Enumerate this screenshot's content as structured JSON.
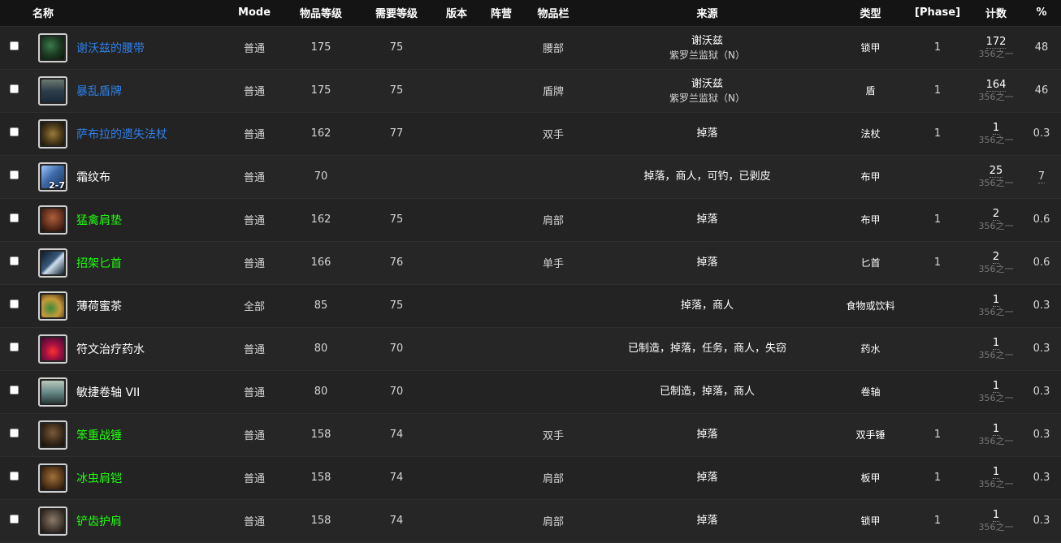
{
  "headers": {
    "name": "名称",
    "mode": "Mode",
    "ilvl": "物品等级",
    "req": "需要等级",
    "version": "版本",
    "faction": "阵营",
    "slot": "物品栏",
    "source": "来源",
    "type": "类型",
    "phase": "[Phase]",
    "count": "计数",
    "pct": "%"
  },
  "rows": [
    {
      "name": "谢沃兹的腰带",
      "quality_color": "#2f7fe8",
      "icon": "belt-icon",
      "mode": "普通",
      "ilvl": "175",
      "req": "75",
      "slot": "腰部",
      "source": "谢沃兹",
      "source_sub": "紫罗兰监狱（N）",
      "type": "锁甲",
      "phase": "1",
      "count": "172",
      "count_sub": "356之一",
      "pct": "48"
    },
    {
      "name": "暴乱盾牌",
      "quality_color": "#2f7fe8",
      "icon": "shield-icon",
      "mode": "普通",
      "ilvl": "175",
      "req": "75",
      "slot": "盾牌",
      "source": "谢沃兹",
      "source_sub": "紫罗兰监狱（N）",
      "type": "盾",
      "phase": "1",
      "count": "164",
      "count_sub": "356之一",
      "pct": "46"
    },
    {
      "name": "萨布拉的遗失法杖",
      "quality_color": "#2f7fe8",
      "icon": "staff-icon",
      "mode": "普通",
      "ilvl": "162",
      "req": "77",
      "slot": "双手",
      "source": "掉落",
      "source_sub": "",
      "type": "法杖",
      "phase": "1",
      "count": "1",
      "count_sub": "356之一",
      "pct": "0.3"
    },
    {
      "name": "霜纹布",
      "quality_color": "#ffffff",
      "icon": "cloth-icon",
      "stack": "2-7",
      "mode": "普通",
      "ilvl": "70",
      "req": "",
      "slot": "",
      "source": "掉落，商人，可钓，已剥皮",
      "source_sub": "",
      "type": "布甲",
      "phase": "",
      "count": "25",
      "count_sub": "356之一",
      "pct": "7"
    },
    {
      "name": "猛禽肩垫",
      "quality_color": "#1eff0c",
      "icon": "shoulder-icon",
      "mode": "普通",
      "ilvl": "162",
      "req": "75",
      "slot": "肩部",
      "source": "掉落",
      "source_sub": "",
      "type": "布甲",
      "phase": "1",
      "count": "2",
      "count_sub": "356之一",
      "pct": "0.6"
    },
    {
      "name": "招架匕首",
      "quality_color": "#1eff0c",
      "icon": "dagger-icon",
      "mode": "普通",
      "ilvl": "166",
      "req": "76",
      "slot": "单手",
      "source": "掉落",
      "source_sub": "",
      "type": "匕首",
      "phase": "1",
      "count": "2",
      "count_sub": "356之一",
      "pct": "0.6"
    },
    {
      "name": "薄荷蜜茶",
      "quality_color": "#ffffff",
      "icon": "tea-icon",
      "mode": "全部",
      "ilvl": "85",
      "req": "75",
      "slot": "",
      "source": "掉落，商人",
      "source_sub": "",
      "type": "食物或饮料",
      "phase": "",
      "count": "1",
      "count_sub": "356之一",
      "pct": "0.3"
    },
    {
      "name": "符文治疗药水",
      "quality_color": "#ffffff",
      "icon": "potion-icon",
      "mode": "普通",
      "ilvl": "80",
      "req": "70",
      "slot": "",
      "source": "已制造，掉落，任务，商人，失窃",
      "source_sub": "",
      "type": "药水",
      "phase": "",
      "count": "1",
      "count_sub": "356之一",
      "pct": "0.3"
    },
    {
      "name": "敏捷卷轴 VII",
      "quality_color": "#ffffff",
      "icon": "scroll-icon",
      "mode": "普通",
      "ilvl": "80",
      "req": "70",
      "slot": "",
      "source": "已制造，掉落，商人",
      "source_sub": "",
      "type": "卷轴",
      "phase": "",
      "count": "1",
      "count_sub": "356之一",
      "pct": "0.3"
    },
    {
      "name": "笨重战锤",
      "quality_color": "#1eff0c",
      "icon": "mace-icon",
      "mode": "普通",
      "ilvl": "158",
      "req": "74",
      "slot": "双手",
      "source": "掉落",
      "source_sub": "",
      "type": "双手锤",
      "phase": "1",
      "count": "1",
      "count_sub": "356之一",
      "pct": "0.3"
    },
    {
      "name": "冰虫肩铠",
      "quality_color": "#1eff0c",
      "icon": "plate-shoulder-icon",
      "mode": "普通",
      "ilvl": "158",
      "req": "74",
      "slot": "肩部",
      "source": "掉落",
      "source_sub": "",
      "type": "板甲",
      "phase": "1",
      "count": "1",
      "count_sub": "356之一",
      "pct": "0.3"
    },
    {
      "name": "铲齿护肩",
      "quality_color": "#1eff0c",
      "icon": "mail-shoulder-icon",
      "mode": "普通",
      "ilvl": "158",
      "req": "74",
      "slot": "肩部",
      "source": "掉落",
      "source_sub": "",
      "type": "锁甲",
      "phase": "1",
      "count": "1",
      "count_sub": "356之一",
      "pct": "0.3"
    }
  ]
}
